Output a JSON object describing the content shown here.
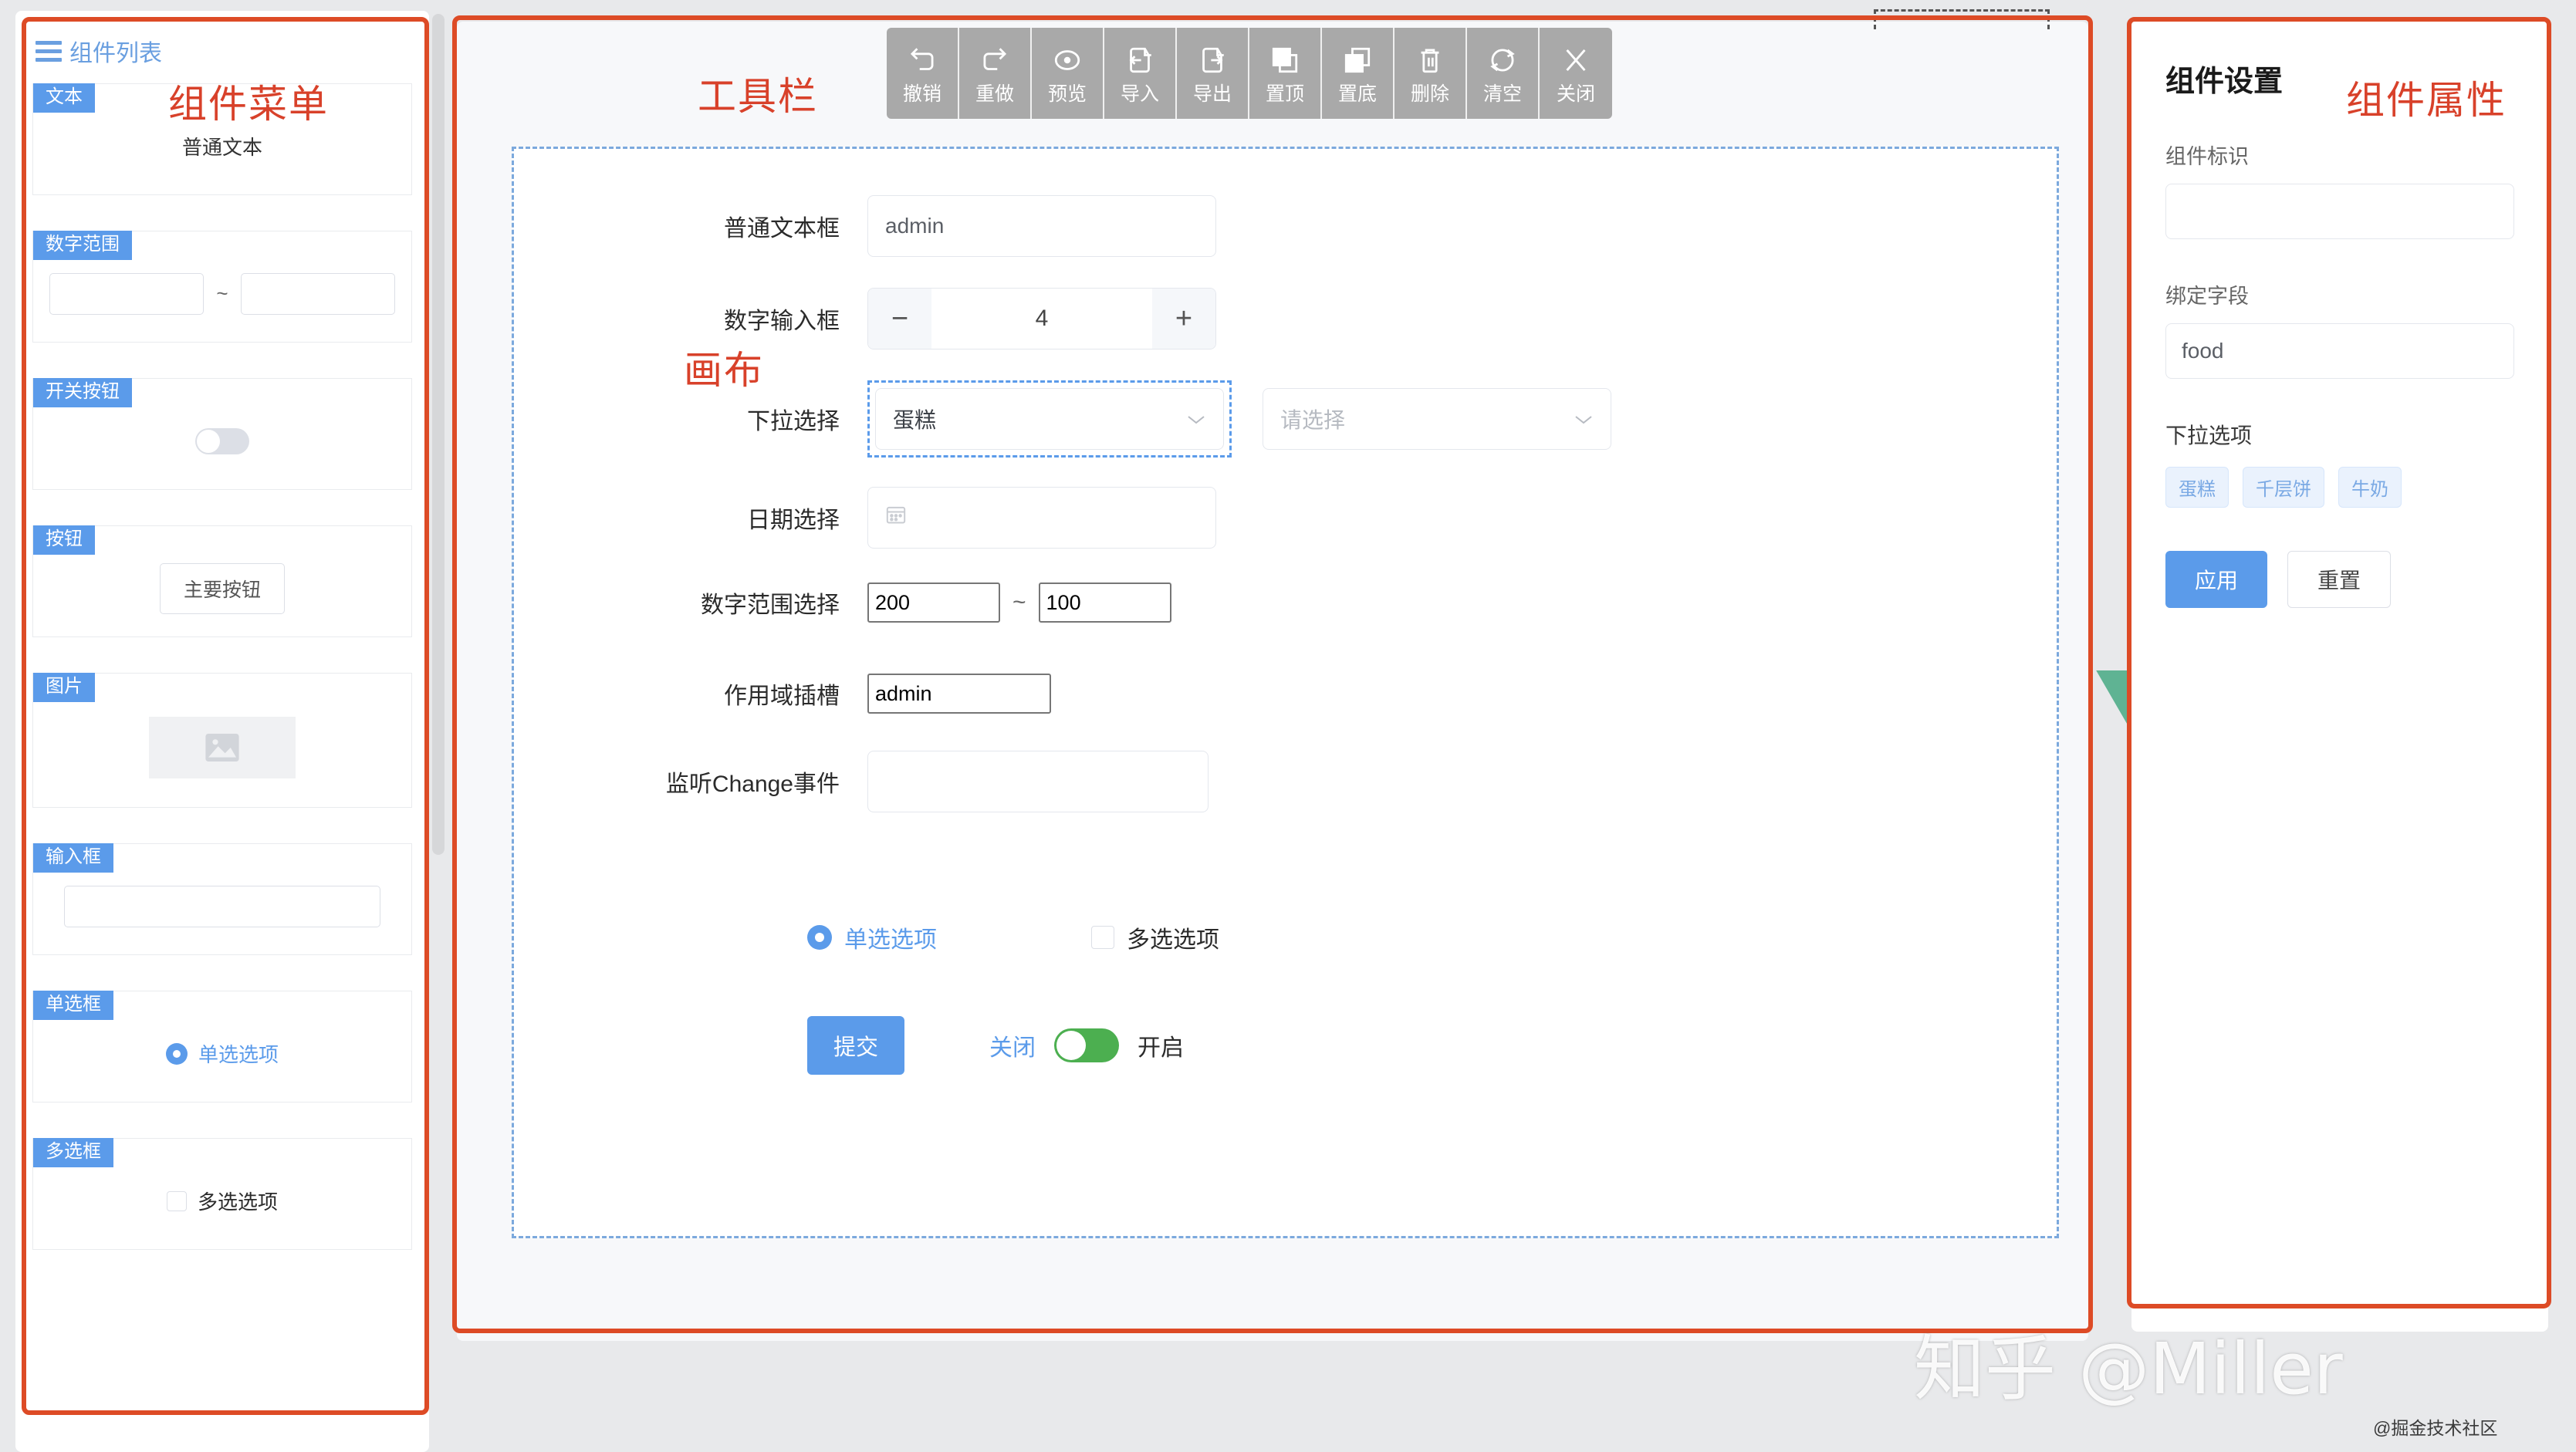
{
  "annotations": {
    "component_menu": "组件菜单",
    "toolbar": "工具栏",
    "canvas": "画布",
    "component_props": "组件属性"
  },
  "left_panel": {
    "header_title": "组件列表",
    "header_icon": "hamburger-menu-icon",
    "components": [
      {
        "tag": "文本",
        "preview_text": "普通文本",
        "kind": "text"
      },
      {
        "tag": "数字范围",
        "separator": "~",
        "kind": "number-range"
      },
      {
        "tag": "开关按钮",
        "kind": "switch"
      },
      {
        "tag": "按钮",
        "button_label": "主要按钮",
        "kind": "button"
      },
      {
        "tag": "图片",
        "kind": "image"
      },
      {
        "tag": "输入框",
        "kind": "input"
      },
      {
        "tag": "单选框",
        "option_label": "单选选项",
        "kind": "radio"
      },
      {
        "tag": "多选框",
        "option_label": "多选选项",
        "kind": "checkbox"
      }
    ]
  },
  "toolbar": {
    "buttons": [
      {
        "label": "撤销",
        "icon": "undo-icon"
      },
      {
        "label": "重做",
        "icon": "redo-icon"
      },
      {
        "label": "预览",
        "icon": "eye-icon"
      },
      {
        "label": "导入",
        "icon": "import-icon"
      },
      {
        "label": "导出",
        "icon": "export-icon"
      },
      {
        "label": "置顶",
        "icon": "bring-to-front-icon"
      },
      {
        "label": "置底",
        "icon": "send-to-back-icon"
      },
      {
        "label": "删除",
        "icon": "trash-icon"
      },
      {
        "label": "清空",
        "icon": "refresh-icon"
      },
      {
        "label": "关闭",
        "icon": "close-icon"
      }
    ]
  },
  "canvas_form": {
    "rows": [
      {
        "label": "普通文本框",
        "value": "admin"
      },
      {
        "label": "数字输入框",
        "value": "4",
        "minus": "−",
        "plus": "+"
      },
      {
        "label": "下拉选择",
        "value": "蛋糕",
        "placeholder_value": "请选择"
      },
      {
        "label": "日期选择",
        "value": ""
      },
      {
        "label": "数字范围选择",
        "min": "200",
        "max": "100",
        "separator": "~"
      },
      {
        "label": "作用域插槽",
        "value": "admin"
      },
      {
        "label": "监听Change事件",
        "value": ""
      }
    ],
    "radio_label": "单选选项",
    "checkbox_label": "多选选项",
    "submit_label": "提交",
    "switch_off_label": "关闭",
    "switch_on_label": "开启",
    "logo": "vue-logo",
    "logo_colors": {
      "green": "#5FB393",
      "navy": "#35495E"
    }
  },
  "right_panel": {
    "title": "组件设置",
    "field_id_label": "组件标识",
    "field_id_value": "",
    "field_bind_label": "绑定字段",
    "field_bind_value": "food",
    "options_label": "下拉选项",
    "options": [
      "蛋糕",
      "千层饼",
      "牛奶"
    ],
    "apply_label": "应用",
    "reset_label": "重置"
  },
  "watermarks": {
    "main": "知乎 @Miller",
    "sub": "@掘金技术社区"
  },
  "colors": {
    "annotation_red": "#dd4b26",
    "accent_blue": "#5b9bea",
    "switch_green": "#4caf50",
    "toolbar_gray": "#a9a9a9"
  }
}
